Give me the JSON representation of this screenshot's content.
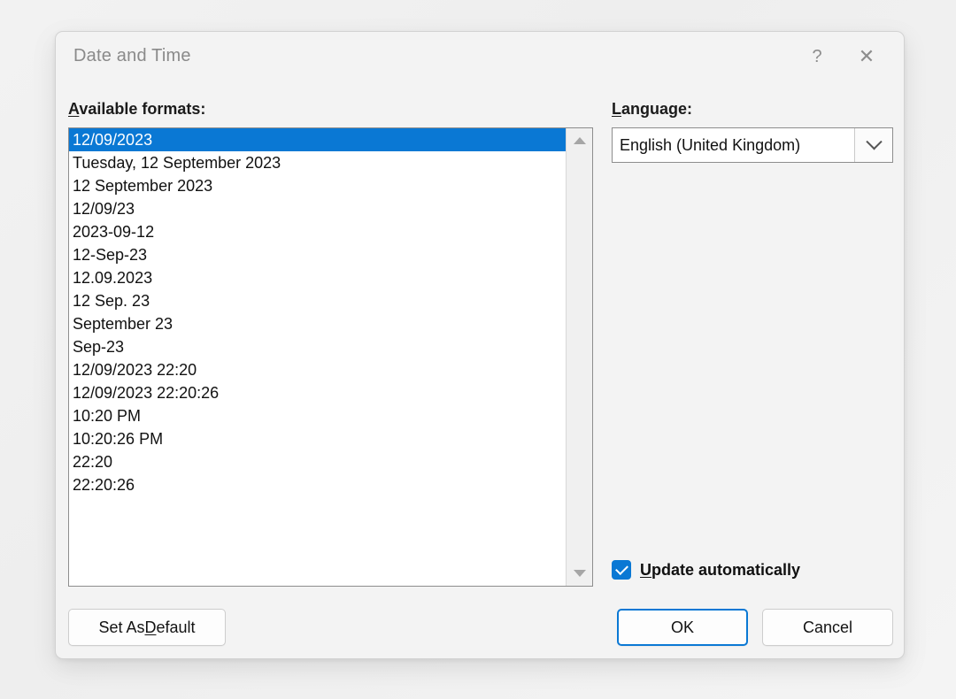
{
  "dialog": {
    "title": "Date and Time",
    "help_icon": "question-mark-icon",
    "close_icon": "close-icon",
    "accent_color": "#0a78d4",
    "background_color": "#f3f3f3"
  },
  "formats": {
    "label_accel": "A",
    "label_rest": "vailable formats:",
    "selected_index": 0,
    "items": [
      "12/09/2023",
      "Tuesday, 12 September 2023",
      "12 September 2023",
      "12/09/23",
      "2023-09-12",
      "12-Sep-23",
      "12.09.2023",
      "12 Sep. 23",
      "September 23",
      "Sep-23",
      "12/09/2023 22:20",
      "12/09/2023 22:20:26",
      "10:20 PM",
      "10:20:26 PM",
      "22:20",
      "22:20:26"
    ],
    "scrollbar": {
      "up_icon": "triangle-up-icon",
      "down_icon": "triangle-down-icon"
    }
  },
  "language": {
    "label_accel": "L",
    "label_rest": "anguage:",
    "selected": "English (United Kingdom)",
    "dropdown_icon": "chevron-down-icon"
  },
  "update_automatically": {
    "checked": true,
    "label_accel": "U",
    "label_rest": "pdate automatically",
    "check_icon": "checkmark-icon"
  },
  "buttons": {
    "set_as_default_pre": "Set As ",
    "set_as_default_accel": "D",
    "set_as_default_post": "efault",
    "ok": "OK",
    "cancel": "Cancel"
  }
}
